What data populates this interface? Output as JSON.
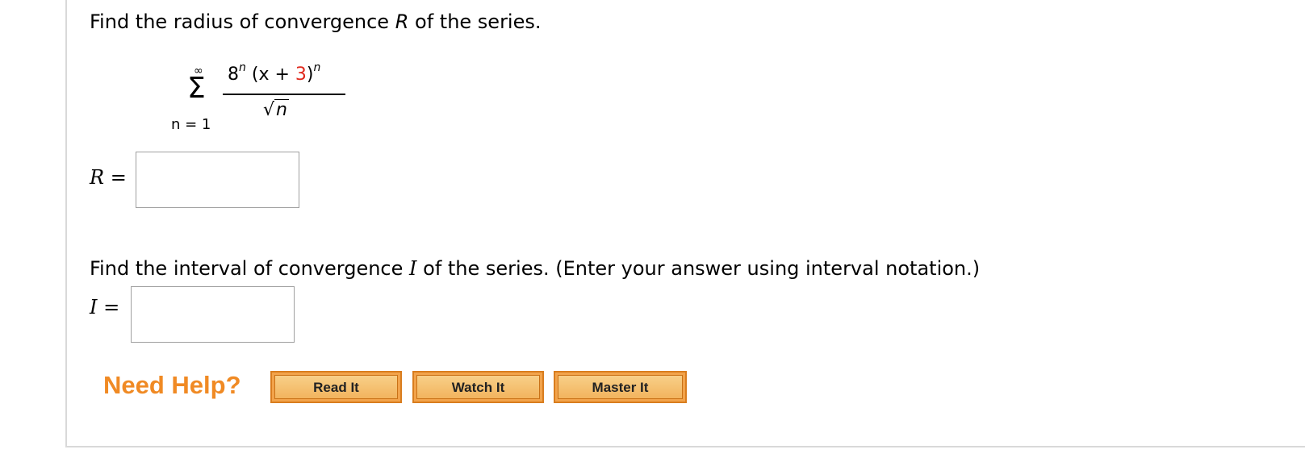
{
  "question1": {
    "text_before": "Find the radius of convergence ",
    "var": "R",
    "text_after": " of the series."
  },
  "series": {
    "upper_limit": "∞",
    "sigma": "Σ",
    "lower_limit": "n = 1",
    "base": "8",
    "exp1": "n",
    "paren_open": "(x + ",
    "constant": "3",
    "paren_close": ")",
    "exp2": "n",
    "sqrt_symbol": "√",
    "radicand": "n",
    "constant_color": "#e0281c"
  },
  "answer_r": {
    "label_var": "R",
    "label_eq": " =",
    "value": ""
  },
  "question2": {
    "text_before": "Find the interval of convergence ",
    "var": "I",
    "text_after": " of the series. (Enter your answer using interval notation.)"
  },
  "answer_i": {
    "label_var": "I",
    "label_eq": " =",
    "value": ""
  },
  "help": {
    "title": "Need Help?",
    "title_color": "#f08a24",
    "read_label": "Read It",
    "watch_label": "Watch It",
    "master_label": "Master It"
  }
}
